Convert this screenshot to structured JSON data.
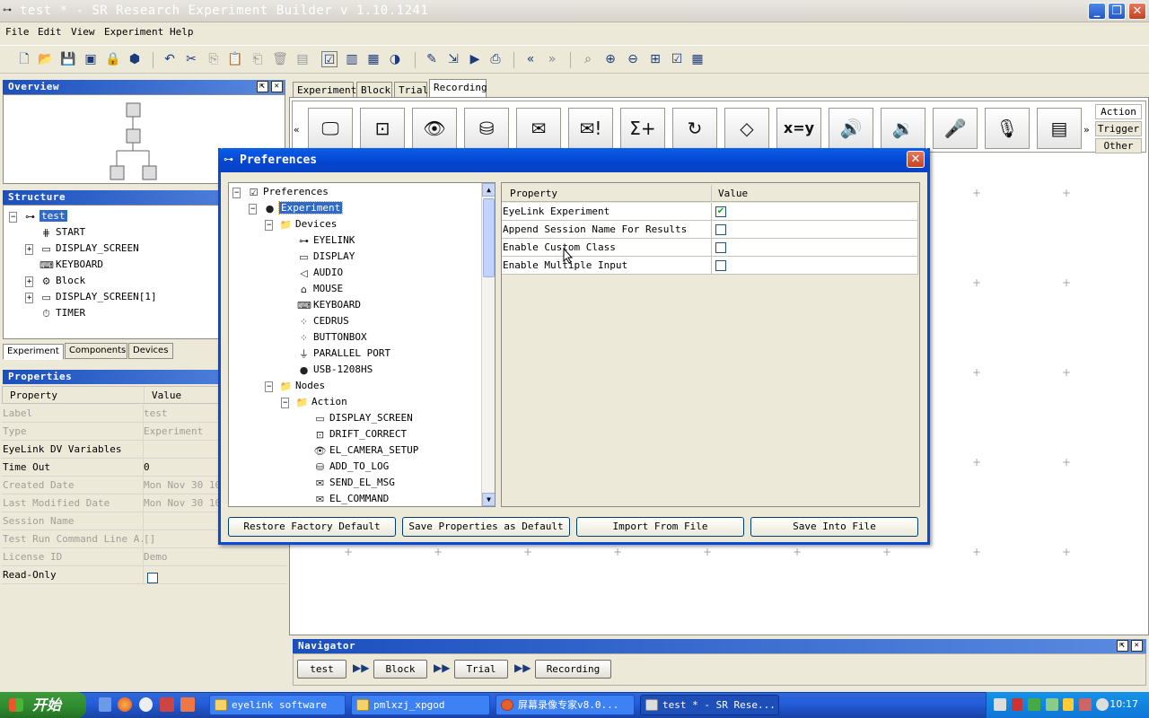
{
  "window": {
    "title": "test * - SR Research Experiment Builder v 1.10.1241"
  },
  "menu": [
    "File",
    "Edit",
    "View",
    "Experiment",
    "Help"
  ],
  "overview": {
    "title": "Overview"
  },
  "structure": {
    "title": "Structure",
    "root": "test",
    "items": [
      "START",
      "DISPLAY_SCREEN",
      "KEYBOARD",
      "Block",
      "DISPLAY_SCREEN[1]",
      "TIMER"
    ],
    "tabs": [
      "Experiment",
      "Components",
      "Devices"
    ]
  },
  "properties": {
    "title": "Properties",
    "col_property": "Property",
    "col_value": "Value",
    "rows": [
      {
        "k": "Label",
        "v": "test"
      },
      {
        "k": "Type",
        "v": "Experiment"
      },
      {
        "k": "EyeLink DV Variables",
        "v": ""
      },
      {
        "k": "Time Out",
        "v": "0"
      },
      {
        "k": "Created Date",
        "v": "Mon Nov 30 10."
      },
      {
        "k": "Last Modified Date",
        "v": "Mon Nov 30 10"
      },
      {
        "k": "Session Name",
        "v": ""
      },
      {
        "k": "Test Run Command Line A.",
        "v": "[]"
      },
      {
        "k": "License ID",
        "v": "Demo"
      },
      {
        "k": "Read-Only",
        "v": ""
      }
    ]
  },
  "canvas_tabs": [
    "Experiment",
    "Block",
    "Trial",
    "Recording"
  ],
  "component_tabs": [
    "Action",
    "Trigger",
    "Other"
  ],
  "dialog": {
    "title": "Preferences",
    "tree": {
      "root": "Preferences",
      "experiment": "Experiment",
      "devices": "Devices",
      "device_items": [
        "EYELINK",
        "DISPLAY",
        "AUDIO",
        "MOUSE",
        "KEYBOARD",
        "CEDRUS",
        "BUTTONBOX",
        "PARALLEL PORT",
        "USB-1208HS"
      ],
      "nodes": "Nodes",
      "action": "Action",
      "action_items": [
        "DISPLAY_SCREEN",
        "DRIFT_CORRECT",
        "EL_CAMERA_SETUP",
        "ADD_TO_LOG",
        "SEND_EL_MSG",
        "EL_COMMAND"
      ]
    },
    "table_header": {
      "property": "Property",
      "value": "Value"
    },
    "table_rows": [
      {
        "name": "EyeLink Experiment",
        "checked": true
      },
      {
        "name": "Append Session Name For Results",
        "checked": false
      },
      {
        "name": "Enable Custom Class",
        "checked": false
      },
      {
        "name": "Enable Multiple Input",
        "checked": false
      }
    ],
    "buttons": [
      "Restore Factory Default",
      "Save Properties as Default",
      "Import From File",
      "Save Into File"
    ]
  },
  "navigator": {
    "title": "Navigator",
    "crumbs": [
      "test",
      "Block",
      "Trial",
      "Recording"
    ]
  },
  "taskbar": {
    "start": "开始",
    "tasks": [
      "eyelink software",
      "pmlxzj_xpgod",
      "屏幕录像专家v8.0...",
      "test * - SR Rese..."
    ],
    "clock": "10:17"
  },
  "colors": {
    "accent": "#245edb",
    "title_blue": "#1b4fbd",
    "selected": "#316ac5"
  }
}
